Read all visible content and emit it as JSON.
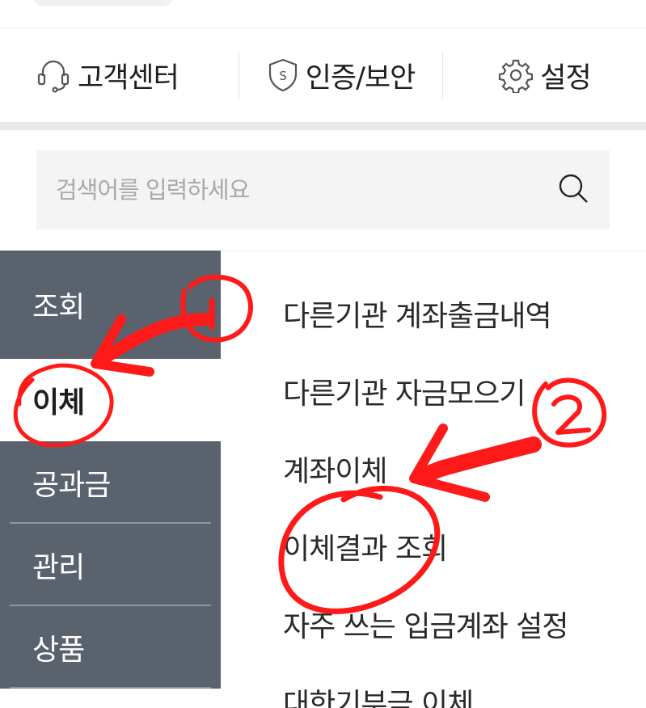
{
  "quick_menu": [
    {
      "label": "고객센터",
      "icon": "headset-icon"
    },
    {
      "label": "인증/보안",
      "icon": "shield-s-icon"
    },
    {
      "label": "설정",
      "icon": "gear-icon"
    }
  ],
  "search": {
    "placeholder": "검색어를 입력하세요",
    "icon": "search-icon"
  },
  "categories": [
    {
      "label": "조회",
      "active": false
    },
    {
      "label": "이체",
      "active": true
    },
    {
      "label": "공과금",
      "active": false
    },
    {
      "label": "관리",
      "active": false
    },
    {
      "label": "상품",
      "active": false
    }
  ],
  "sub_menu": [
    "다른기관 계좌출금내역",
    "다른기관 자금모으기",
    "계좌이체",
    "이체결과 조회",
    "자주 쓰는 입금계좌 설정",
    "대한기부금 이체"
  ],
  "annotations": {
    "color": "#ff1a1a",
    "markers": [
      "1",
      "2"
    ]
  },
  "colors": {
    "category_bg": "#5a626e",
    "category_active_bg": "#ffffff",
    "search_bg": "#f4f4f5"
  }
}
